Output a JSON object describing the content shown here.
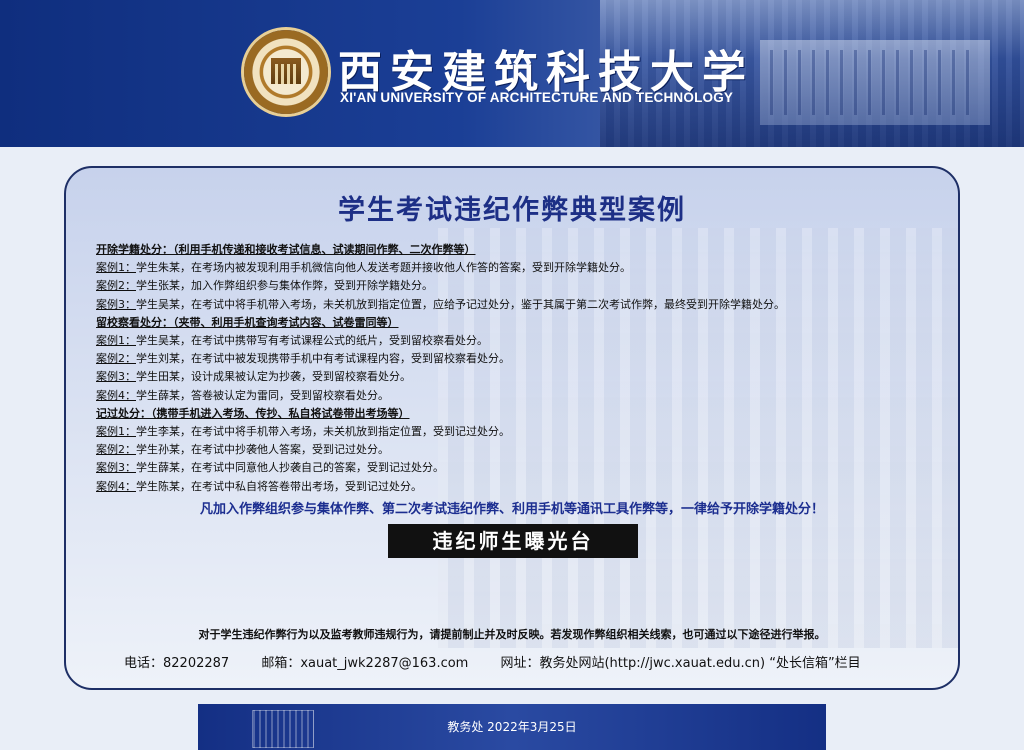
{
  "header": {
    "chinese_name": "西安建筑科技大学",
    "english_name": "XI'AN UNIVERSITY OF ARCHITECTURE AND TECHNOLOGY"
  },
  "title": "学生考试违纪作弊典型案例",
  "sections": {
    "expel": {
      "heading": "开除学籍处分：（利用手机传递和接收考试信息、试读期间作弊、二次作弊等）",
      "cases": [
        {
          "tag": "案例1：",
          "text": "学生朱某，在考场内被发现利用手机微信向他人发送考题并接收他人作答的答案，受到开除学籍处分。"
        },
        {
          "tag": "案例2：",
          "text": "学生张某，加入作弊组织参与集体作弊，受到开除学籍处分。"
        },
        {
          "tag": "案例3：",
          "text": "学生吴某，在考试中将手机带入考场，未关机放到指定位置，应给予记过处分，鉴于其属于第二次考试作弊，最终受到开除学籍处分。"
        }
      ]
    },
    "probation": {
      "heading": "留校察看处分：（夹带、利用手机查询考试内容、试卷雷同等）",
      "cases": [
        {
          "tag": "案例1：",
          "text": "学生吴某，在考试中携带写有考试课程公式的纸片，受到留校察看处分。"
        },
        {
          "tag": "案例2：",
          "text": "学生刘某，在考试中被发现携带手机中有考试课程内容，受到留校察看处分。"
        },
        {
          "tag": "案例3：",
          "text": "学生田某，设计成果被认定为抄袭，受到留校察看处分。"
        },
        {
          "tag": "案例4：",
          "text": "学生薛某，答卷被认定为雷同，受到留校察看处分。"
        }
      ]
    },
    "demerit": {
      "heading": "记过处分：（携带手机进入考场、传抄、私自将试卷带出考场等）",
      "cases": [
        {
          "tag": "案例1：",
          "text": "学生李某，在考试中将手机带入考场，未关机放到指定位置，受到记过处分。"
        },
        {
          "tag": "案例2：",
          "text": "学生孙某，在考试中抄袭他人答案，受到记过处分。"
        },
        {
          "tag": "案例3：",
          "text": "学生薛某，在考试中同意他人抄袭自己的答案，受到记过处分。"
        },
        {
          "tag": "案例4：",
          "text": "学生陈某，在考试中私自将答卷带出考场，受到记过处分。"
        }
      ]
    }
  },
  "notice": "凡加入作弊组织参与集体作弊、第二次考试违纪作弊、利用手机等通讯工具作弊等，一律给予开除学籍处分！",
  "exposure_label": "违纪师生曝光台",
  "report_text": "对于学生违纪作弊行为以及监考教师违规行为，请提前制止并及时反映。若发现作弊组织相关线索，也可通过以下途径进行举报。",
  "contact": {
    "phone": "电话：82202287",
    "email": "邮箱：xauat_jwk2287@163.com",
    "website": "网址：教务处网站(http://jwc.xauat.edu.cn) “处长信箱”栏目"
  },
  "footer": {
    "text": "教务处  2022年3月25日"
  },
  "colors": {
    "banner": "#1b3f96",
    "title": "#1d2f86",
    "notice": "#1c2e90",
    "footer": "#142f84"
  }
}
